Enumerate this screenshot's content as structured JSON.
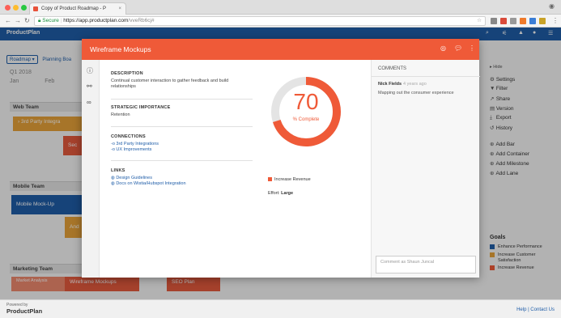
{
  "browser": {
    "tab_title": "Copy of Product Roadmap - P",
    "url_secure": "Secure",
    "url_host": "https://app.productplan.com",
    "url_path": "/vveRb6cj#"
  },
  "app": {
    "brand": "ProductPlan",
    "toolbar": {
      "roadmap_label": "Roadmap ▾",
      "planning_label": "Planning Boa"
    },
    "timeline": {
      "quarter": "Q1 2018",
      "months": [
        "Jan",
        "Feb"
      ]
    },
    "lanes": [
      {
        "name": "Web Team",
        "bars": [
          "3rd Party Integra",
          "Sec"
        ]
      },
      {
        "name": "Mobile Team",
        "bars": [
          "Mobile Mock-Up",
          "And"
        ]
      },
      {
        "name": "Marketing Team",
        "bars": [
          "Market Analysis",
          "Wireframe Mockups",
          "SEO Plan"
        ]
      }
    ]
  },
  "sidebar": {
    "hide_label": "Hide",
    "items": [
      {
        "label": "Settings",
        "icon": "gear-icon"
      },
      {
        "label": "Filter",
        "icon": "filter-icon"
      },
      {
        "label": "Share",
        "icon": "share-icon"
      },
      {
        "label": "Version",
        "icon": "version-icon"
      },
      {
        "label": "Export",
        "icon": "export-icon"
      },
      {
        "label": "History",
        "icon": "history-icon"
      },
      {
        "label": "Add Bar",
        "icon": "add-icon"
      },
      {
        "label": "Add Container",
        "icon": "add-icon"
      },
      {
        "label": "Add Milestone",
        "icon": "add-icon"
      },
      {
        "label": "Add Lane",
        "icon": "add-icon"
      }
    ],
    "goals_title": "Goals",
    "goals": [
      {
        "label": "Enhance Performance",
        "color": "#1f5da8"
      },
      {
        "label": "Increase Customer Satisfaction",
        "color": "#e8a33a"
      },
      {
        "label": "Increase Revenue",
        "color": "#ef5a38"
      }
    ]
  },
  "footer": {
    "powered_by": "Powered by",
    "brand": "ProductPlan",
    "help": "Help | Contact Us"
  },
  "modal": {
    "title": "Wireframe Mockups",
    "description_header": "DESCRIPTION",
    "description": "Continual customer interaction to gather feedback and build relationships",
    "importance_header": "STRATEGIC IMPORTANCE",
    "importance": "Retention",
    "connections_header": "CONNECTIONS",
    "connections": [
      "3rd Party Integrations",
      "UX Improvements"
    ],
    "links_header": "LINKS",
    "links": [
      "Design Guidelines",
      "Docs on Wistia/Hubspot Integration"
    ],
    "percent_complete": 70,
    "percent_label": "% Complete",
    "goal": "Increase Revenue",
    "goal_color": "#ef5a38",
    "effort_label": "Effort:",
    "effort_value": "Large",
    "comments_header": "COMMENTS",
    "comment_author": "Nick Fields",
    "comment_ago": "4 years ago",
    "comment_text": "Mapping out the consumer experience",
    "comment_placeholder": "Comment as Shaun Juncal"
  }
}
